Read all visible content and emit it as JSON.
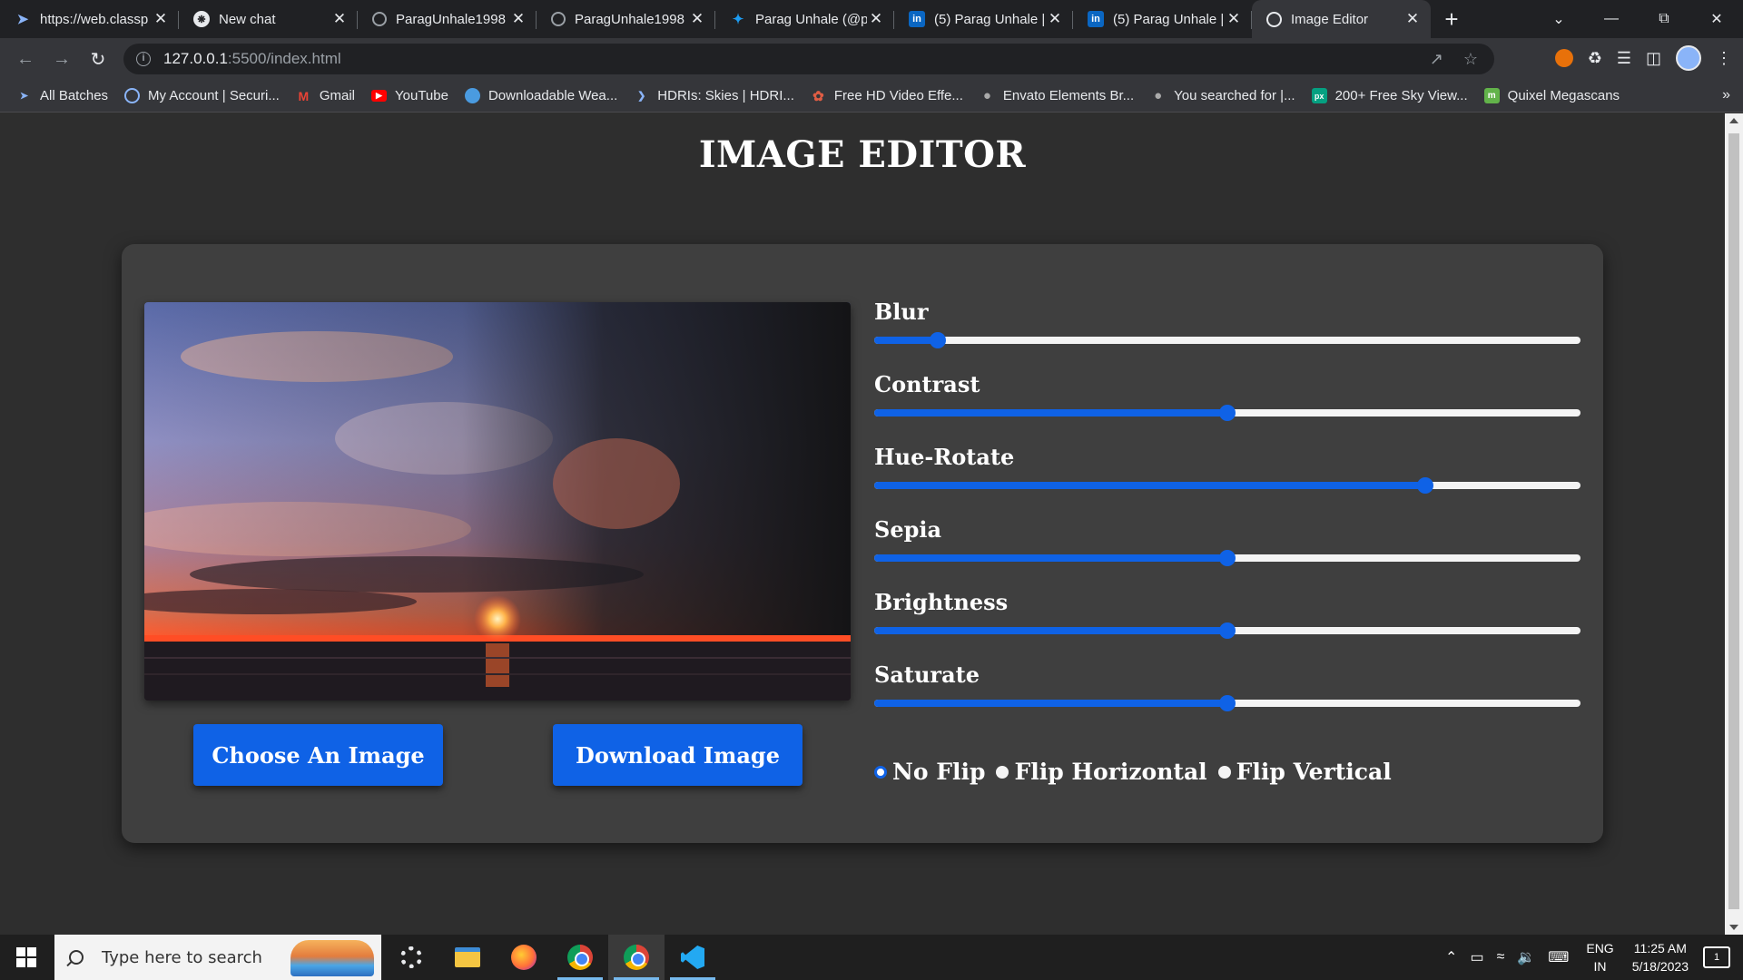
{
  "browser": {
    "tabs": [
      {
        "title": "https://web.classp",
        "favicon": "arrow-icon",
        "active": false
      },
      {
        "title": "New chat",
        "favicon": "chatgpt-icon",
        "active": false
      },
      {
        "title": "ParagUnhale1998",
        "favicon": "github-icon",
        "active": false
      },
      {
        "title": "ParagUnhale1998",
        "favicon": "github-icon",
        "active": false
      },
      {
        "title": "Parag Unhale (@p",
        "favicon": "twitter-icon",
        "active": false
      },
      {
        "title": "(5) Parag Unhale |",
        "favicon": "linkedin-icon",
        "active": false
      },
      {
        "title": "(5) Parag Unhale |",
        "favicon": "linkedin-icon",
        "active": false
      },
      {
        "title": "Image Editor",
        "favicon": "globe-icon",
        "active": true
      }
    ],
    "url_host": "127.0.0.1",
    "url_path": ":5500/index.html",
    "bookmarks": [
      {
        "label": "All Batches",
        "icon": "arrow-icon",
        "color": "#8ab4f8"
      },
      {
        "label": "My Account | Securi...",
        "icon": "shield-icon",
        "color": "#8ab4f8"
      },
      {
        "label": "Gmail",
        "icon": "gmail-icon",
        "color": "#ea4335"
      },
      {
        "label": "YouTube",
        "icon": "youtube-icon",
        "color": "#ff0000"
      },
      {
        "label": "Downloadable Wea...",
        "icon": "globe-icon",
        "color": "#4a9be0"
      },
      {
        "label": "HDRIs: Skies | HDRI...",
        "icon": "hdri-icon",
        "color": "#8ab4f8"
      },
      {
        "label": "Free HD Video Effe...",
        "icon": "effects-icon",
        "color": "#e05d44"
      },
      {
        "label": "Envato Elements Br...",
        "icon": "envato-icon",
        "color": "#555555"
      },
      {
        "label": "You searched for |...",
        "icon": "envato-icon",
        "color": "#555555"
      },
      {
        "label": "200+ Free Sky View...",
        "icon": "pexels-icon",
        "color": "#05a081"
      },
      {
        "label": "Quixel Megascans",
        "icon": "megascans-icon",
        "color": "#62b34a"
      }
    ]
  },
  "app": {
    "title": "IMAGE EDITOR",
    "buttons": {
      "choose": "Choose An Image",
      "download": "Download Image"
    },
    "filters": [
      {
        "label": "Blur",
        "value_pct": 9
      },
      {
        "label": "Contrast",
        "value_pct": 50
      },
      {
        "label": "Hue-Rotate",
        "value_pct": 78
      },
      {
        "label": "Sepia",
        "value_pct": 50
      },
      {
        "label": "Brightness",
        "value_pct": 50
      },
      {
        "label": "Saturate",
        "value_pct": 50
      }
    ],
    "flip_options": [
      {
        "label": "No Flip",
        "checked": true
      },
      {
        "label": "Flip Horizontal",
        "checked": false
      },
      {
        "label": "Flip Vertical",
        "checked": false
      }
    ],
    "colors": {
      "accent": "#0f62e6",
      "card": "#3f3f3f",
      "page": "#2e2e2e"
    }
  },
  "taskbar": {
    "search_placeholder": "Type here to search",
    "lang_top": "ENG",
    "lang_bottom": "IN",
    "time": "11:25 AM",
    "date": "5/18/2023",
    "notifications": "1"
  }
}
